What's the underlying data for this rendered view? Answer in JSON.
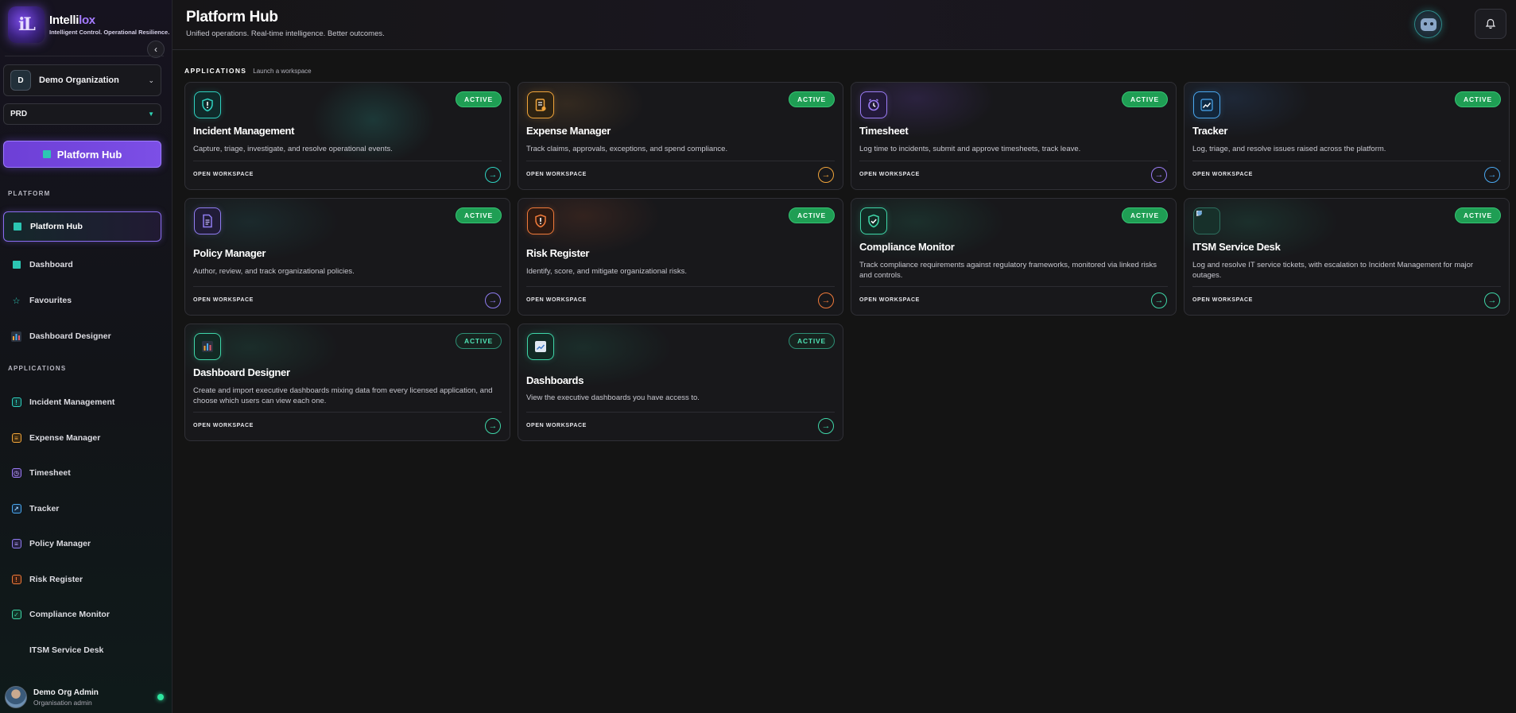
{
  "brand": {
    "name_prefix": "Intelli",
    "name_suffix": "lox",
    "tagline": "Intelligent Control. Operational Resilience.",
    "logo_letters": "iL"
  },
  "sidebar": {
    "org": {
      "badge": "D",
      "name": "Demo Organization"
    },
    "env": {
      "name": "PRD"
    },
    "hub_button": "Platform Hub",
    "platform_label": "PLATFORM",
    "platform_items": [
      {
        "label": "Platform Hub"
      },
      {
        "label": "Dashboard"
      },
      {
        "label": "Favourites"
      },
      {
        "label": "Dashboard Designer"
      }
    ],
    "applications_label": "APPLICATIONS",
    "application_items": [
      {
        "label": "Incident Management"
      },
      {
        "label": "Expense Manager"
      },
      {
        "label": "Timesheet"
      },
      {
        "label": "Tracker"
      },
      {
        "label": "Policy Manager"
      },
      {
        "label": "Risk Register"
      },
      {
        "label": "Compliance Monitor"
      },
      {
        "label": "ITSM Service Desk"
      }
    ],
    "user": {
      "name": "Demo Org Admin",
      "role": "Organisation admin"
    }
  },
  "header": {
    "title": "Platform Hub",
    "subtitle": "Unified operations. Real-time intelligence. Better outcomes."
  },
  "apps_section": {
    "title": "APPLICATIONS",
    "subtitle": "Launch a workspace"
  },
  "cards": [
    {
      "title": "Incident Management",
      "desc": "Capture, triage, investigate, and resolve operational events.",
      "status": "ACTIVE",
      "open": "OPEN WORKSPACE",
      "accent": "#2fd1c0",
      "icon": "shield-alert-icon"
    },
    {
      "title": "Expense Manager",
      "desc": "Track claims, approvals, exceptions, and spend compliance.",
      "status": "ACTIVE",
      "open": "OPEN WORKSPACE",
      "accent": "#f0a43a",
      "icon": "receipt-icon"
    },
    {
      "title": "Timesheet",
      "desc": "Log time to incidents, submit and approve timesheets, track leave.",
      "status": "ACTIVE",
      "open": "OPEN WORKSPACE",
      "accent": "#9b7cf5",
      "icon": "clock-icon"
    },
    {
      "title": "Tracker",
      "desc": "Log, triage, and resolve issues raised across the platform.",
      "status": "ACTIVE",
      "open": "OPEN WORKSPACE",
      "accent": "#4aa8f0",
      "icon": "trend-chart-icon"
    },
    {
      "title": "Policy Manager",
      "desc": "Author, review, and track organizational policies.",
      "status": "ACTIVE",
      "open": "OPEN WORKSPACE",
      "accent": "#8f7cf0",
      "icon": "document-icon"
    },
    {
      "title": "Risk Register",
      "desc": "Identify, score, and mitigate organizational risks.",
      "status": "ACTIVE",
      "open": "OPEN WORKSPACE",
      "accent": "#f07a3a",
      "icon": "shield-alert-icon"
    },
    {
      "title": "Compliance Monitor",
      "desc": "Track compliance requirements against regulatory frameworks, monitored via linked risks and controls.",
      "status": "ACTIVE",
      "open": "OPEN WORKSPACE",
      "accent": "#3fd6a8",
      "icon": "shield-check-icon"
    },
    {
      "title": "ITSM Service Desk",
      "desc": "Log and resolve IT service tickets, with escalation to Incident Management for major outages.",
      "status": "ACTIVE",
      "open": "OPEN WORKSPACE",
      "accent": "#3fd6a8",
      "icon": "broken-image-icon"
    },
    {
      "title": "Dashboard Designer",
      "desc": "Create and import executive dashboards mixing data from every licensed application, and choose which users can view each one.",
      "status": "ACTIVE",
      "open": "OPEN WORKSPACE",
      "accent": "#3fd6a8",
      "icon": "bar-chart-icon"
    },
    {
      "title": "Dashboards",
      "desc": "View the executive dashboards you have access to.",
      "status": "ACTIVE",
      "open": "OPEN WORKSPACE",
      "accent": "#3fd6a8",
      "icon": "line-chart-icon"
    }
  ]
}
